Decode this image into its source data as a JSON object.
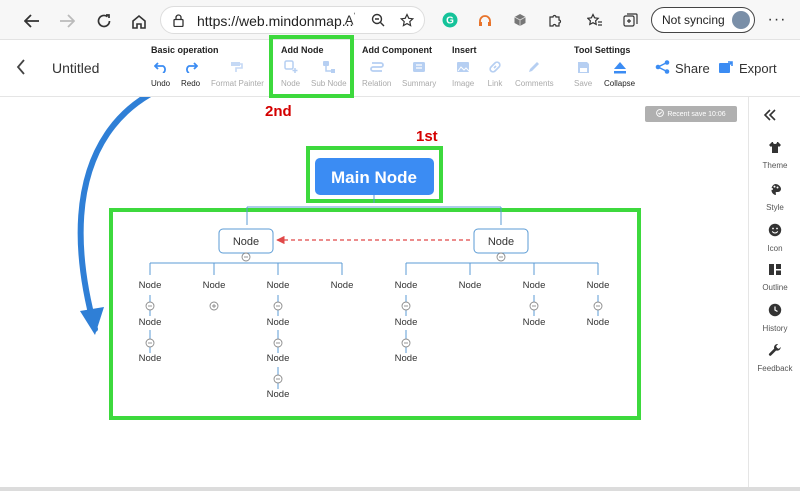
{
  "browser": {
    "url": "https://web.mindonmap...",
    "sync_label": "Not syncing"
  },
  "app": {
    "doc_title": "Untitled",
    "groups": {
      "basic": "Basic operation",
      "add_node": "Add Node",
      "add_component": "Add Component",
      "insert": "Insert",
      "tool_settings": "Tool Settings"
    },
    "tools": {
      "undo": "Undo",
      "redo": "Redo",
      "format_painter": "Format Painter",
      "node": "Node",
      "sub_node": "Sub Node",
      "relation": "Relation",
      "summary": "Summary",
      "image": "Image",
      "link": "Link",
      "comments": "Comments",
      "save": "Save",
      "collapse": "Collapse"
    },
    "share": "Share",
    "export": "Export",
    "recent_save": "Recent save 10:06"
  },
  "sidebar": {
    "theme": "Theme",
    "style": "Style",
    "icon": "Icon",
    "outline": "Outline",
    "history": "History",
    "feedback": "Feedback"
  },
  "mindmap": {
    "main_node": "Main Node",
    "node_label": "Node"
  },
  "annotations": {
    "first": "1st",
    "second": "2nd"
  },
  "colors": {
    "accent_blue": "#3b8cf3",
    "highlight_green": "#3dd93d",
    "annotation_red": "#d40000",
    "connector": "#5b9bd5"
  }
}
